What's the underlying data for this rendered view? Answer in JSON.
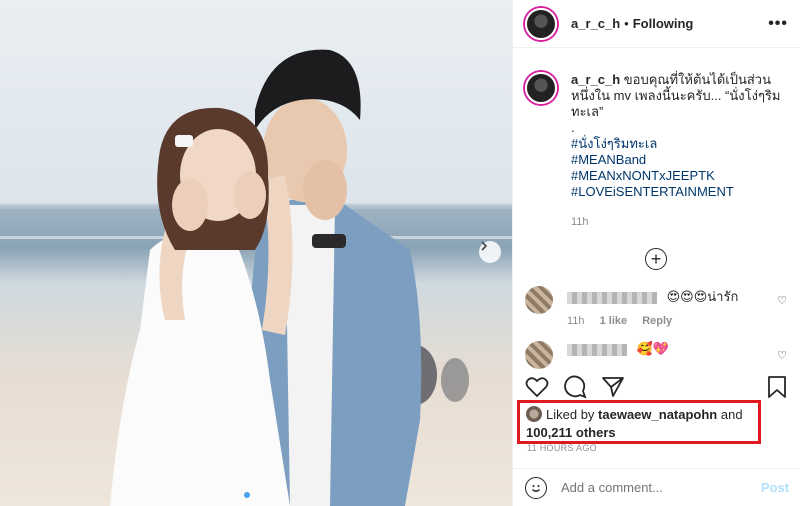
{
  "post": {
    "username": "a_r_c_h",
    "follow_status": "Following",
    "bullet": "•",
    "more_label": "•••"
  },
  "caption": {
    "username": "a_r_c_h",
    "text": "ขอบคุณที่ให้ต้นได้เป็นส่วนหนึ่งใน mv เพลงนี้นะครับ... “นั่งโง่ๆริมทะเล”",
    "dot": ".",
    "hashtags": [
      "#นั่งโง่ๆริมทะเล",
      "#MEANBand",
      "#MEANxNONTxJEEPTK",
      "#LOVEiSENTERTAINMENT"
    ],
    "time": "11h"
  },
  "comments": [
    {
      "text": "😍😍😍น่ารัก",
      "time": "11h",
      "likes": "1 like",
      "reply": "Reply"
    },
    {
      "text": "🥰💖"
    }
  ],
  "likes": {
    "prefix": "Liked by",
    "user": "taewaew_natapohn",
    "and": "and",
    "others": "100,211 others"
  },
  "timestamp": "11 HOURS AGO",
  "add_comment": {
    "placeholder": "Add a comment...",
    "post_label": "Post"
  },
  "colors": {
    "highlight_box": "#e0191f",
    "link": "#00376b",
    "post_disabled": "#b2dffc",
    "carousel_active_dot": "#4aa1ef"
  },
  "carousel": {
    "current": 1,
    "total": 2
  }
}
